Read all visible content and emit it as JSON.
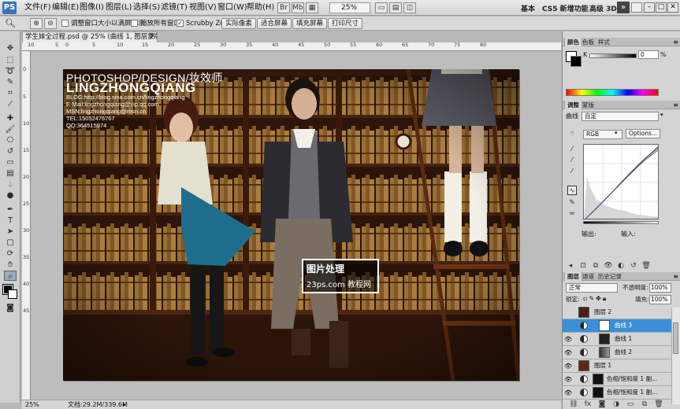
{
  "app": {
    "logo": "PS"
  },
  "menu": [
    "文件(F)",
    "编辑(E)",
    "图像(I)",
    "图层(L)",
    "选择(S)",
    "滤镜(T)",
    "视图(V)",
    "窗口(W)",
    "帮助(H)"
  ],
  "menubar_right": {
    "zoom": "25%",
    "workspaces": [
      "基本",
      "CS5 新增功能",
      "高级 3D"
    ],
    "more": "»",
    "window_buttons": [
      "–",
      "□",
      "✕"
    ]
  },
  "options": {
    "resize_windows": "调整窗口大小以满屏显示",
    "zoom_all": "缩放所有窗口",
    "scrubby": "Scrubby Zoom",
    "buttons": [
      "实际像素",
      "适合屏幕",
      "填充屏幕",
      "打印尺寸"
    ]
  },
  "document": {
    "tab": "学生妹全过程.psd @ 25% (曲线 1, 图层蒙版/8) *",
    "close": "×",
    "ruler_top": [
      "10",
      "5",
      "0",
      "5",
      "10",
      "15",
      "20",
      "25",
      "30",
      "35",
      "40",
      "45",
      "50",
      "55",
      "60",
      "65",
      "70",
      "75",
      "80"
    ],
    "ruler_left": [
      "0",
      "5",
      "10",
      "15",
      "20",
      "25",
      "30",
      "35",
      "40",
      "45"
    ],
    "status_zoom": "25%",
    "status_doc": "文档:29.2M/339.6M"
  },
  "photo": {
    "title": "PHOTOSHOP/DESIGN/妆效师",
    "name": "LINGZHONGQIANG",
    "lines": [
      "BLOG:http://blog.sina.com.cn/lingzhongqiang",
      "E-Mail:lingzhongqiang@vip.qq.com",
      "MSN:lingzhongqiang@msn.cn",
      "TEL:15052476767",
      "QQ:364515974"
    ],
    "logo_line1": "图片处理",
    "logo_line2": "23ps.com 教程网"
  },
  "color_panel": {
    "tabs": [
      "颜色",
      "色板",
      "样式"
    ],
    "channel": "K",
    "value": "0",
    "unit": "%"
  },
  "adjust_panel": {
    "tabs": [
      "调整",
      "蒙版"
    ],
    "type_label": "曲线",
    "preset": "自定",
    "channel": "RGB",
    "options_btn": "Options...",
    "output": "输出:",
    "input": "输入:"
  },
  "layers_panel": {
    "tabs": [
      "图层",
      "通道",
      "历史记录"
    ],
    "blend_mode": "正常",
    "opacity_label": "不透明度:",
    "opacity": "100%",
    "lock_label": "锁定:",
    "fill_label": "填充:",
    "fill": "100%",
    "layers": [
      {
        "name": "图层 2",
        "type": "pixel",
        "visible": false,
        "selected": false
      },
      {
        "name": "曲线 3",
        "type": "adjust",
        "visible": false,
        "selected": true
      },
      {
        "name": "曲线 1",
        "type": "adjust",
        "visible": true,
        "selected": false
      },
      {
        "name": "曲线 2",
        "type": "adjust",
        "visible": true,
        "selected": false
      },
      {
        "name": "图层 1",
        "type": "pixel",
        "visible": true,
        "selected": false
      },
      {
        "name": "色相/饱和度 1 副...",
        "type": "adjust",
        "visible": true,
        "selected": false
      },
      {
        "name": "色相/饱和度 1 副...",
        "type": "adjust",
        "visible": true,
        "selected": false
      }
    ]
  }
}
